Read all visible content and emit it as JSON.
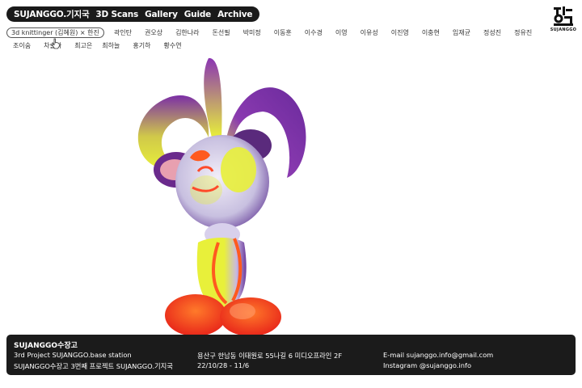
{
  "nav": {
    "items": [
      "SUJANGGO.기지국",
      "3D Scans",
      "Gallery",
      "Guide",
      "Archive"
    ]
  },
  "logo": {
    "text": "SUJANGGO",
    "icon": "sujanggo-logo-icon"
  },
  "artists": {
    "selected": "3d knittinger (김혜원) × 한진",
    "items": [
      "곽인탄",
      "권오상",
      "김한나라",
      "돈선필",
      "박미정",
      "이동훈",
      "이수경",
      "이영",
      "이유성",
      "이진영",
      "이충현",
      "임재균",
      "정성진",
      "정유진",
      "조이숨",
      "차슬아",
      "최고은"
    ],
    "row2": [
      "최하늘",
      "홍기하",
      "황수연"
    ]
  },
  "model": {
    "description_icon": "3d-scan-figure-icon"
  },
  "footer": {
    "title": "SUJANGGO수장고",
    "project": "3rd Project SUJANGGO.base station",
    "project_kr": "SUJANGGO수장고 3번째 프로젝트 SUJANGGO.기지국",
    "address": "용산구 한남동 이태원로 55나길 6 미디오프라인 2F",
    "dates": "22/10/28 - 11/6",
    "email": "E-mail sujanggo.info@gmail.com",
    "instagram": "Instagram @sujanggo.info"
  },
  "colors": {
    "nav_bg": "#1a1a1a",
    "footer_bg": "#1b1b1b",
    "purple": "#7b2fa6",
    "yellow": "#e8f03a",
    "orange": "#ff5a1f"
  }
}
